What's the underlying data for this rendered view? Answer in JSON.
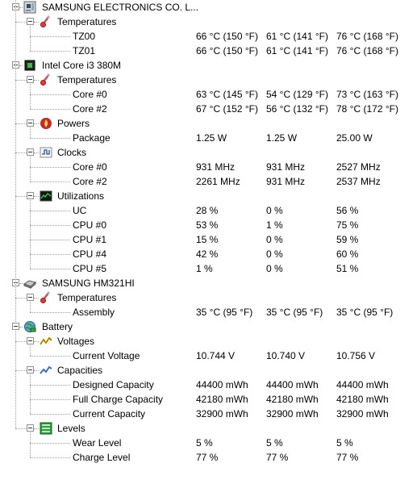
{
  "tree": {
    "devices": [
      {
        "name": "SAMSUNG ELECTRONICS CO. L...",
        "icon": "motherboard-icon",
        "groups": [
          {
            "name": "Temperatures",
            "icon": "thermometer-icon",
            "sensors": [
              {
                "name": "TZ00",
                "value": "66 °C  (150 °F)",
                "min": "61 °C  (141 °F)",
                "max": "76 °C  (168 °F)"
              },
              {
                "name": "TZ01",
                "value": "66 °C  (150 °F)",
                "min": "61 °C  (141 °F)",
                "max": "76 °C  (168 °F)"
              }
            ]
          }
        ]
      },
      {
        "name": "Intel Core i3 380M",
        "icon": "cpu-chip-icon",
        "groups": [
          {
            "name": "Temperatures",
            "icon": "thermometer-icon",
            "sensors": [
              {
                "name": "Core #0",
                "value": "63 °C  (145 °F)",
                "min": "54 °C  (129 °F)",
                "max": "73 °C  (163 °F)"
              },
              {
                "name": "Core #2",
                "value": "67 °C  (152 °F)",
                "min": "56 °C  (132 °F)",
                "max": "78 °C  (172 °F)"
              }
            ]
          },
          {
            "name": "Powers",
            "icon": "power-flame-icon",
            "sensors": [
              {
                "name": "Package",
                "value": "1.25 W",
                "min": "1.25 W",
                "max": "25.00 W"
              }
            ]
          },
          {
            "name": "Clocks",
            "icon": "clock-wave-icon",
            "sensors": [
              {
                "name": "Core #0",
                "value": "931 MHz",
                "min": "931 MHz",
                "max": "2527 MHz"
              },
              {
                "name": "Core #2",
                "value": "2261 MHz",
                "min": "931 MHz",
                "max": "2537 MHz"
              }
            ]
          },
          {
            "name": "Utilizations",
            "icon": "utilization-graph-icon",
            "sensors": [
              {
                "name": "UC",
                "value": "28 %",
                "min": "0 %",
                "max": "56 %"
              },
              {
                "name": "CPU #0",
                "value": "53 %",
                "min": "1 %",
                "max": "75 %"
              },
              {
                "name": "CPU #1",
                "value": "15 %",
                "min": "0 %",
                "max": "59 %"
              },
              {
                "name": "CPU #4",
                "value": "42 %",
                "min": "0 %",
                "max": "60 %"
              },
              {
                "name": "CPU #5",
                "value": "1 %",
                "min": "0 %",
                "max": "51 %"
              }
            ]
          }
        ]
      },
      {
        "name": "SAMSUNG HM321HI",
        "icon": "hard-drive-icon",
        "groups": [
          {
            "name": "Temperatures",
            "icon": "thermometer-icon",
            "sensors": [
              {
                "name": "Assembly",
                "value": "35 °C  (95 °F)",
                "min": "35 °C  (95 °F)",
                "max": "35 °C  (95 °F)"
              }
            ]
          }
        ]
      },
      {
        "name": "Battery",
        "icon": "battery-globe-icon",
        "groups": [
          {
            "name": "Voltages",
            "icon": "voltage-zigzag-icon",
            "sensors": [
              {
                "name": "Current Voltage",
                "value": "10.744 V",
                "min": "10.740 V",
                "max": "10.756 V"
              }
            ]
          },
          {
            "name": "Capacities",
            "icon": "capacity-graph-icon",
            "sensors": [
              {
                "name": "Designed Capacity",
                "value": "44400 mWh",
                "min": "44400 mWh",
                "max": "44400 mWh"
              },
              {
                "name": "Full Charge Capacity",
                "value": "42180 mWh",
                "min": "42180 mWh",
                "max": "42180 mWh"
              },
              {
                "name": "Current Capacity",
                "value": "32900 mWh",
                "min": "32900 mWh",
                "max": "32900 mWh"
              }
            ]
          },
          {
            "name": "Levels",
            "icon": "level-bars-icon",
            "sensors": [
              {
                "name": "Wear Level",
                "value": "5 %",
                "min": "5 %",
                "max": "5 %"
              },
              {
                "name": "Charge Level",
                "value": "77 %",
                "min": "77 %",
                "max": "77 %"
              }
            ]
          }
        ]
      }
    ]
  }
}
